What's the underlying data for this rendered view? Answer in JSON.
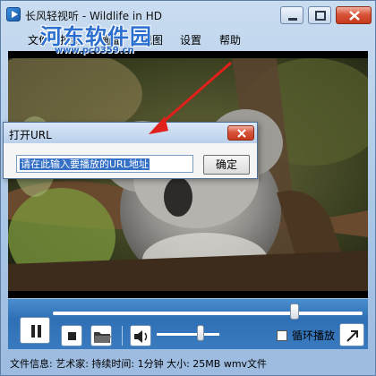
{
  "window": {
    "title": "长风轻视听 - Wildlife in HD"
  },
  "watermark": {
    "logo_text": "河东软件园",
    "url_text": "www.pc0359.cn"
  },
  "menu": {
    "items": [
      {
        "label": "文件"
      },
      {
        "label": "控制"
      },
      {
        "label": "画面"
      },
      {
        "label": "视图"
      },
      {
        "label": "设置"
      },
      {
        "label": "帮助"
      }
    ]
  },
  "playback": {
    "seek_position": 0.78,
    "volume": 0.7,
    "loop_label": "循环播放",
    "loop_checked": false
  },
  "status": {
    "text": "文件信息:   艺术家:   持续时间: 1分钟 大小: 25MB wmv文件"
  },
  "dialog": {
    "title": "打开URL",
    "input_value": "请在此输入要播放的URL地址",
    "ok_label": "确定"
  },
  "colors": {
    "control_bar": "#3a7bc0",
    "annotation_arrow": "#e0201a",
    "selection": "#3470c6"
  }
}
